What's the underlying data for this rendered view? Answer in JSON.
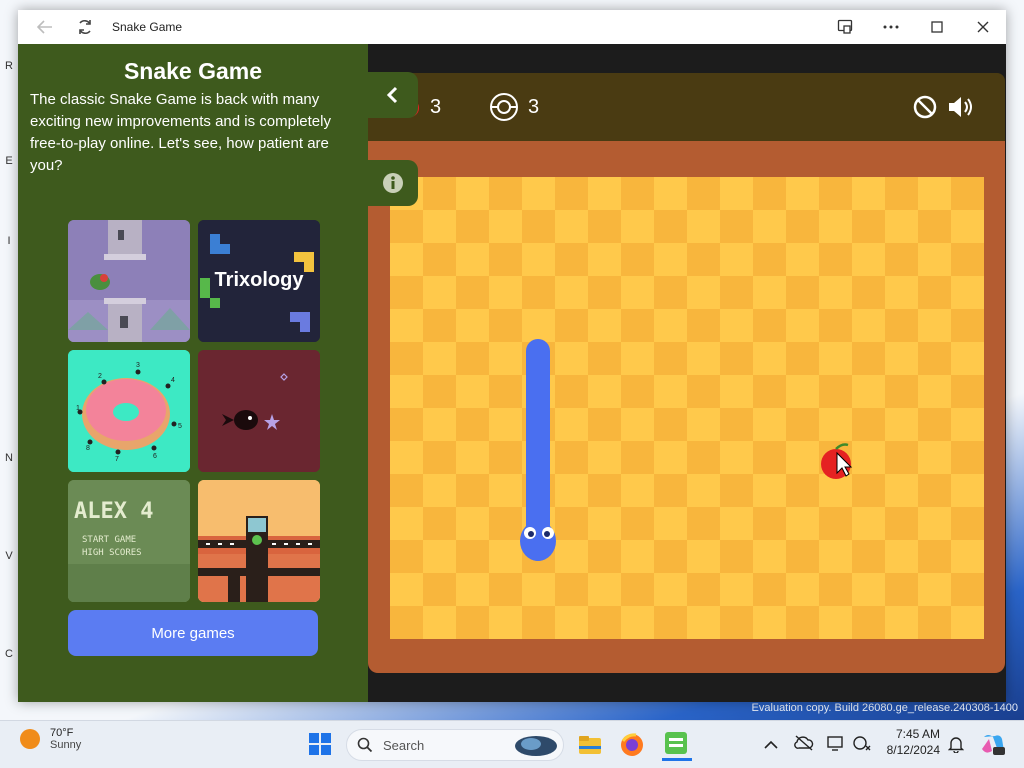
{
  "window": {
    "title": "Snake Game"
  },
  "panel": {
    "title": "Snake Game",
    "description": "The classic Snake Game is back with many exciting new improvements and is completely free-to-play online. Let's see, how patient are you?",
    "games": [
      {
        "name": "flappy-style game"
      },
      {
        "name": "Trixology",
        "label": "Trixology"
      },
      {
        "name": "connect-dots donut game",
        "numbers": [
          "1",
          "2",
          "3",
          "4",
          "5",
          "6",
          "7",
          "8"
        ]
      },
      {
        "name": "space creature game"
      },
      {
        "name": "Alex 4",
        "title": "ALEX 4",
        "line1": "START GAME",
        "line2": "HIGH SCORES"
      },
      {
        "name": "platform game"
      }
    ],
    "more_games_label": "More games"
  },
  "game": {
    "apples_count": "3",
    "target_count": "3"
  },
  "desktop": {
    "watermark": "Evaluation copy. Build 26080.ge_release.240308-1400",
    "edge_letters": [
      "R",
      "E",
      "I",
      "N",
      "V",
      "C"
    ]
  },
  "taskbar": {
    "weather_temp": "70°F",
    "weather_cond": "Sunny",
    "search_placeholder": "Search",
    "time": "7:45 AM",
    "date": "8/12/2024",
    "colors": {
      "bar": "#e9eef5",
      "start_blue": "#1e73e8"
    }
  },
  "colors": {
    "panel_green": "#3e5a1d",
    "board_light": "#ffc94b",
    "board_dark": "#f8b63d",
    "frame": "#b45c31",
    "snake": "#4a6ff0",
    "apple": "#e52222",
    "button": "#5b7cf2"
  }
}
